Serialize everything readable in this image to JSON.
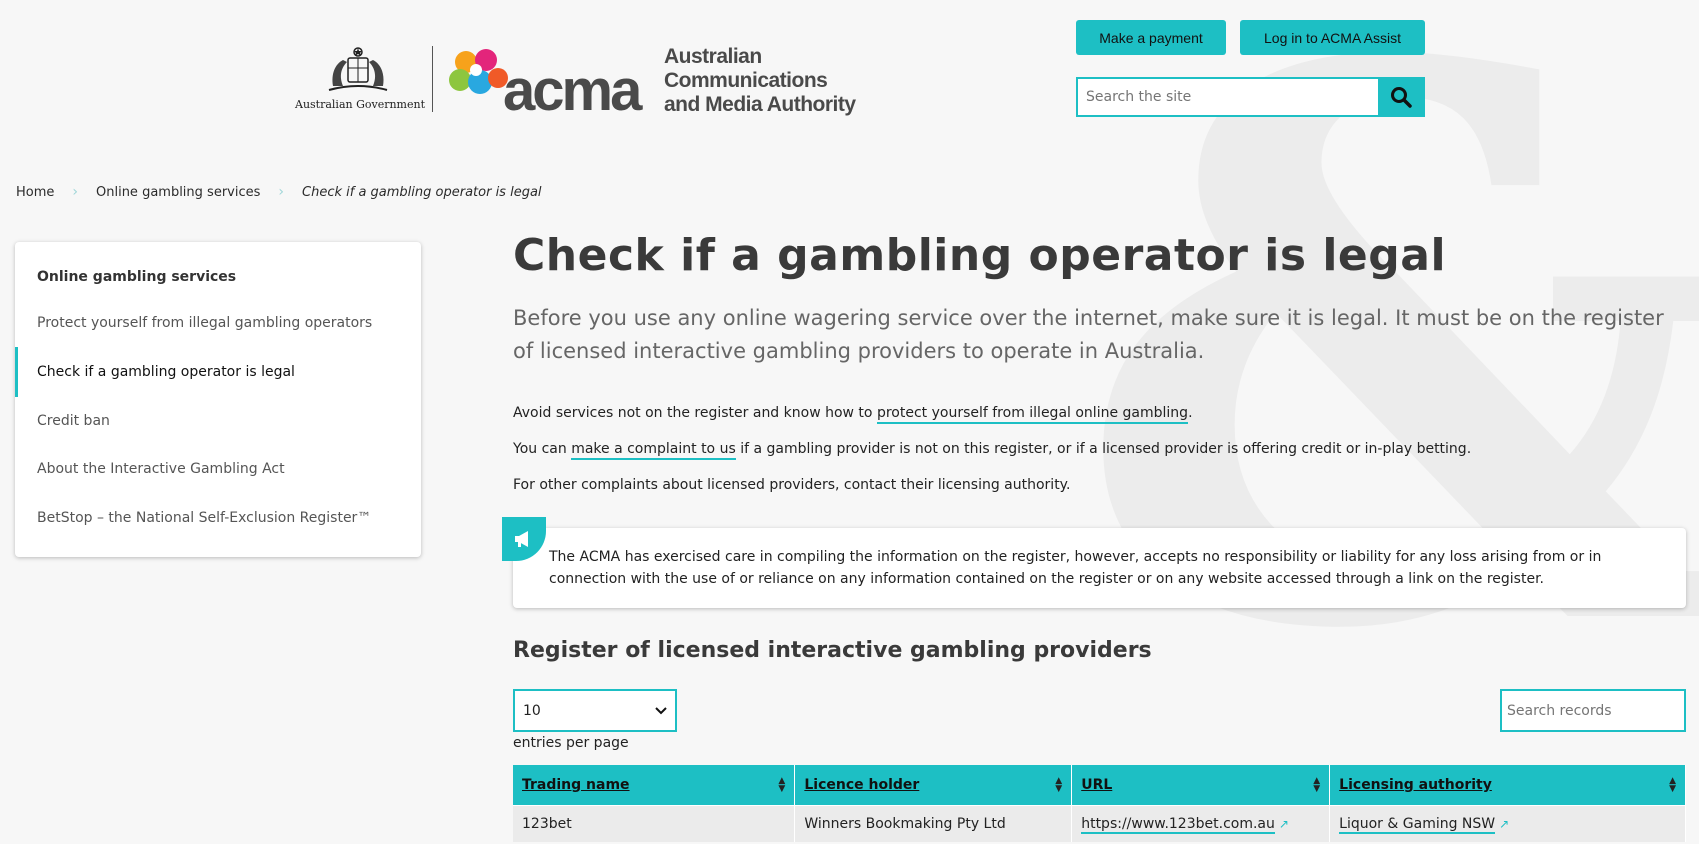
{
  "header": {
    "gov_label": "Australian Government",
    "acma_word": "acma",
    "acma_full_lines": [
      "Australian",
      "Communications",
      "and Media Authority"
    ],
    "make_payment": "Make a payment",
    "login": "Log in to ACMA Assist",
    "search_placeholder": "Search the site"
  },
  "breadcrumb": {
    "home": "Home",
    "section": "Online gambling services",
    "current": "Check if a gambling operator is legal"
  },
  "sidebar": {
    "title": "Online gambling services",
    "items": [
      {
        "label": "Protect yourself from illegal gambling operators"
      },
      {
        "label": "Check if a gambling operator is legal"
      },
      {
        "label": "Credit ban"
      },
      {
        "label": "About the Interactive Gambling Act"
      },
      {
        "label": "BetStop – the National Self-Exclusion Register™"
      }
    ]
  },
  "main": {
    "title": "Check if a gambling operator is legal",
    "lead": "Before you use any online wagering service over the internet, make sure it is legal. It must be on the register of licensed interactive gambling providers to operate in Australia.",
    "p1_before": "Avoid services not on the register and know how to ",
    "p1_link": "protect yourself from illegal online gambling",
    "p1_after": ".",
    "p2_before": "You can ",
    "p2_link": "make a complaint to us",
    "p2_after": " if a gambling provider is not on this register, or if a licensed provider is offering credit or in-play betting.",
    "p3": "For other complaints about licensed providers, contact their licensing authority.",
    "notice": "The ACMA has exercised care in compiling the information on the register, however, accepts no responsibility or liability for any loss arising from or in connection with the use of or reliance on any information contained on the register or on any website accessed through a link on the register.",
    "register_title": "Register of licensed interactive gambling providers",
    "entries_value": "10",
    "entries_label": "entries per page",
    "records_placeholder": "Search records"
  },
  "table": {
    "headers": [
      "Trading name",
      "Licence holder",
      "URL",
      "Licensing authority"
    ],
    "rows": [
      [
        "123bet",
        "Winners Bookmaking Pty Ltd",
        "https://www.123bet.com.au",
        "Liquor & Gaming NSW"
      ]
    ]
  },
  "colors": {
    "accent": "#1dbfc4",
    "background": "#f7f7f7"
  }
}
